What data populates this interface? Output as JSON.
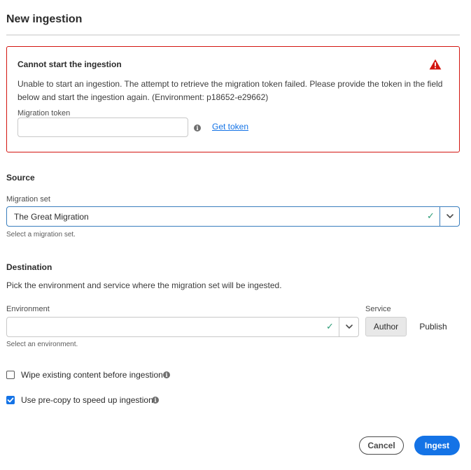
{
  "dialog": {
    "title": "New ingestion"
  },
  "error": {
    "title": "Cannot start the ingestion",
    "message": "Unable to start an ingestion. The attempt to retrieve the migration token failed. Please provide the token in the field below and start the ingestion again.  (Environment: p18652-e29662)",
    "icon": "alert-triangle-icon",
    "color": "#d31510",
    "token_label": "Migration token",
    "token_value": "",
    "get_token_label": "Get token"
  },
  "source": {
    "title": "Source",
    "migration_set_label": "Migration set",
    "migration_set_value": "The Great Migration",
    "help": "Select a migration set."
  },
  "destination": {
    "title": "Destination",
    "description": "Pick the environment and service where the migration set will be ingested.",
    "environment_label": "Environment",
    "environment_value": "",
    "environment_help": "Select an environment.",
    "service_label": "Service",
    "service_options": [
      "Author",
      "Publish"
    ],
    "service_selected": "Author"
  },
  "options": {
    "wipe_label": "Wipe existing content before ingestion",
    "wipe_checked": false,
    "precopy_label": "Use pre-copy to speed up ingestion",
    "precopy_checked": true
  },
  "actions": {
    "cancel_label": "Cancel",
    "ingest_label": "Ingest",
    "accent": "#1473e6"
  }
}
